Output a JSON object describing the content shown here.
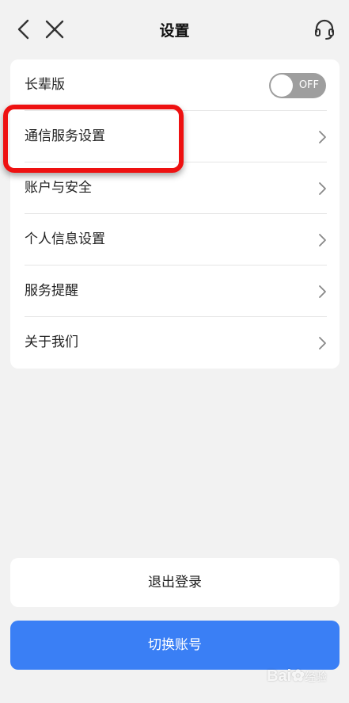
{
  "header": {
    "title": "设置",
    "back_icon": "chevron-left-icon",
    "close_icon": "close-icon",
    "service_icon": "headset-icon"
  },
  "settings": {
    "elder_mode": {
      "label": "长辈版",
      "toggle_state": "OFF"
    },
    "items": [
      {
        "label": "通信服务设置"
      },
      {
        "label": "账户与安全"
      },
      {
        "label": "个人信息设置"
      },
      {
        "label": "服务提醒"
      },
      {
        "label": "关于我们"
      }
    ]
  },
  "actions": {
    "logout_label": "退出登录",
    "switch_label": "切换账号"
  },
  "watermark": {
    "brand": "Bai",
    "sub": "经验"
  },
  "colors": {
    "background": "#f2f2f2",
    "primary_button": "#3a7ff5",
    "highlight_border": "#ee1111",
    "toggle_off": "#9e9e9e"
  }
}
